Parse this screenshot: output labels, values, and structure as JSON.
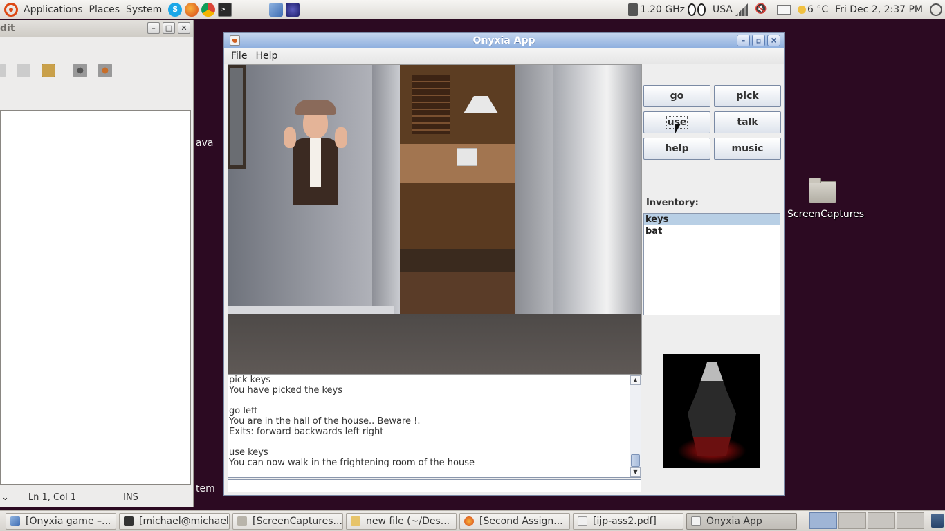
{
  "top_panel": {
    "menus": [
      "Applications",
      "Places",
      "System"
    ],
    "launchers": [
      "skype-icon",
      "firefox-icon",
      "chrome-icon",
      "terminal-icon",
      "cube-icon",
      "eclipse-icon"
    ],
    "cpu_freq": "1.20 GHz",
    "keyboard_layout": "USA",
    "weather": "6 °C",
    "clock": "Fri Dec  2,  2:37 PM"
  },
  "gedit": {
    "title_fragment": "dit",
    "status_position": "Ln 1, Col 1",
    "status_mode": "INS"
  },
  "desktop": {
    "fragment_java": "ava",
    "fragment_system": "tem",
    "folder_label": "ScreenCaptures"
  },
  "onyxia": {
    "title": "Onyxia App",
    "menu": {
      "file": "File",
      "help": "Help"
    },
    "buttons": {
      "go": "go",
      "pick": "pick",
      "use": "use",
      "talk": "talk",
      "help": "help",
      "music": "music"
    },
    "inventory_label": "Inventory:",
    "inventory": [
      "keys",
      "bat"
    ],
    "inventory_selected": "keys",
    "log": [
      "pick keys",
      "You have picked the keys",
      "",
      "go left",
      "You are in the hall of the house.. Beware !.",
      "Exits: forward backwards left right",
      "",
      "use keys",
      "You can now walk in the frightening room of the house"
    ],
    "command_input": ""
  },
  "taskbar": {
    "tasks": [
      {
        "label": "[Onyxia game –...",
        "icon": "cube-icon"
      },
      {
        "label": "[michael@michael...",
        "icon": "terminal-icon"
      },
      {
        "label": "[ScreenCaptures...",
        "icon": "folder-icon"
      },
      {
        "label": "new file (~/Des...",
        "icon": "edit-icon"
      },
      {
        "label": "[Second Assign...",
        "icon": "firefox-icon"
      },
      {
        "label": "[ijp-ass2.pdf]",
        "icon": "pdf-icon"
      },
      {
        "label": "Onyxia App",
        "icon": "java-icon"
      }
    ]
  },
  "colors": {
    "desktop_bg": "#2c0a22",
    "titlebar_active": "#8fb0df",
    "inventory_selected": "#b8cfe5"
  }
}
